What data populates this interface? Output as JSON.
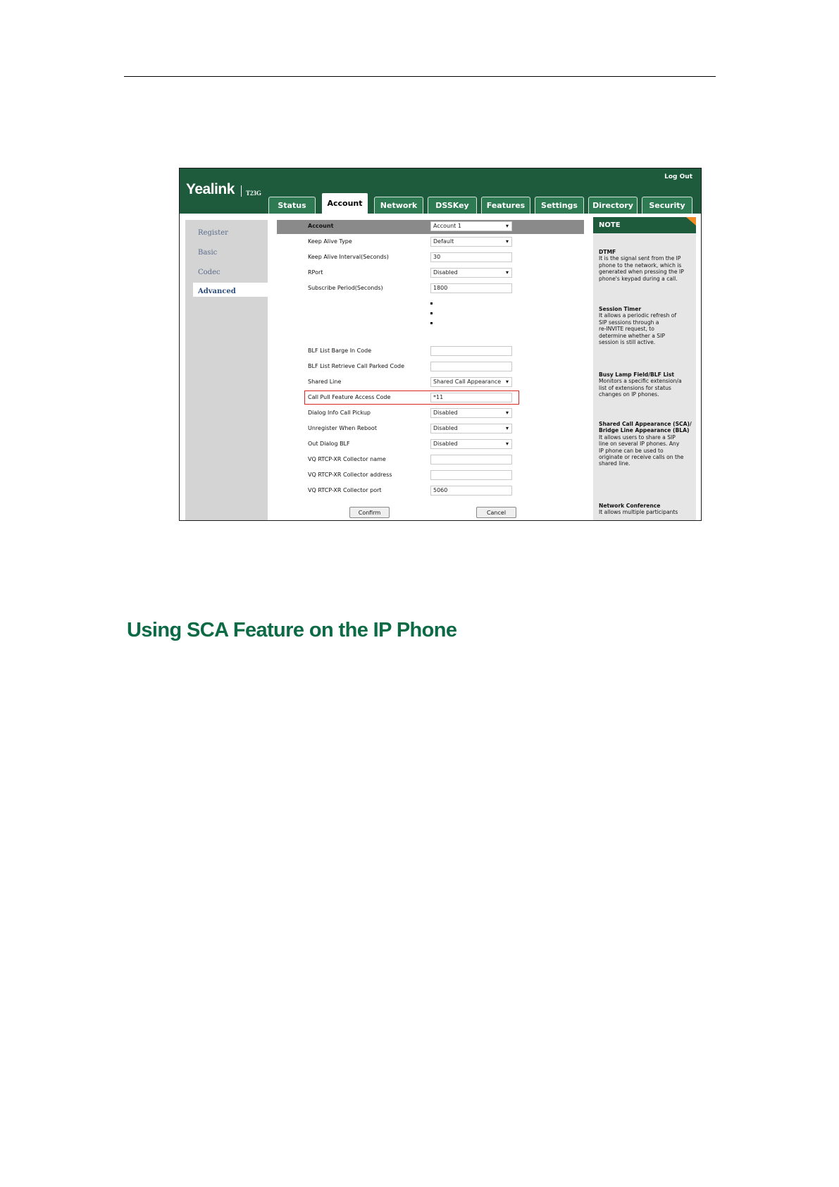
{
  "screenshot": {
    "brand": "Yealink",
    "model": "T23G",
    "logout": "Log Out",
    "tabs": [
      "Status",
      "Account",
      "Network",
      "DSSKey",
      "Features",
      "Settings",
      "Directory",
      "Security"
    ],
    "active_tab": "Account",
    "sidebar": [
      "Register",
      "Basic",
      "Codec",
      "Advanced"
    ],
    "active_sidebar": "Advanced",
    "rows_top": [
      {
        "label": "Account",
        "value": "Account 1",
        "type": "select"
      },
      {
        "label": "Keep Alive Type",
        "value": "Default",
        "type": "select"
      },
      {
        "label": "Keep Alive Interval(Seconds)",
        "value": "30",
        "type": "text"
      },
      {
        "label": "RPort",
        "value": "Disabled",
        "type": "select"
      },
      {
        "label": "Subscribe Period(Seconds)",
        "value": "1800",
        "type": "text"
      }
    ],
    "rows_bottom": [
      {
        "label": "BLF List Barge In Code",
        "value": "",
        "type": "text"
      },
      {
        "label": "BLF List Retrieve Call Parked Code",
        "value": "",
        "type": "text"
      },
      {
        "label": "Shared Line",
        "value": "Shared Call Appearance",
        "type": "select"
      },
      {
        "label": "Call Pull Feature Access Code",
        "value": "*11",
        "type": "text"
      },
      {
        "label": "Dialog Info Call Pickup",
        "value": "Disabled",
        "type": "select"
      },
      {
        "label": "Unregister When Reboot",
        "value": "Disabled",
        "type": "select"
      },
      {
        "label": "Out Dialog BLF",
        "value": "Disabled",
        "type": "select"
      },
      {
        "label": "VQ RTCP-XR Collector name",
        "value": "",
        "type": "text"
      },
      {
        "label": "VQ RTCP-XR Collector address",
        "value": "",
        "type": "text"
      },
      {
        "label": "VQ RTCP-XR Collector port",
        "value": "5060",
        "type": "text"
      }
    ],
    "buttons": {
      "confirm": "Confirm",
      "cancel": "Cancel"
    },
    "note": {
      "header": "NOTE",
      "blocks": [
        {
          "title": "DTMF",
          "lines": [
            "It is the signal sent from the IP",
            "phone to the network, which is",
            "generated when pressing the IP",
            "phone's keypad during a call."
          ]
        },
        {
          "title": "Session Timer",
          "lines": [
            "It allows a periodic refresh of",
            "SIP sessions through a",
            "re-INVITE request, to",
            "determine whether a SIP",
            "session is still active."
          ]
        },
        {
          "title": "Busy Lamp Field/BLF List",
          "lines": [
            "Monitors a specific extension/a",
            "list of extensions for status",
            "changes on IP phones."
          ]
        },
        {
          "title": "Shared Call Appearance (SCA)/ Bridge Line Appearance (BLA)",
          "lines": [
            "It allows users to share a SIP",
            "line on several IP phones. Any",
            "IP phone can be used to",
            "originate or receive calls on the",
            "shared line."
          ]
        },
        {
          "title": "Network Conference",
          "lines": [
            "It allows multiple participants"
          ]
        }
      ]
    },
    "colors": {
      "brand_green": "#1e5b3d",
      "tab_green": "#2e7a52",
      "highlight_red": "#d9251d",
      "note_accent": "#f08a24"
    }
  },
  "heading": "Using SCA Feature on the IP Phone"
}
